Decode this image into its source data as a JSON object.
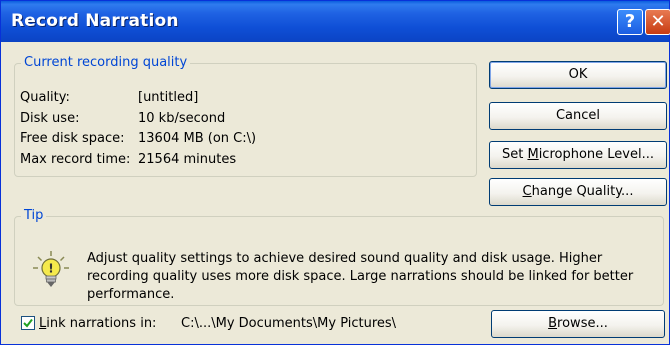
{
  "window": {
    "title": "Record Narration"
  },
  "title_buttons": {
    "help": "?",
    "close": "✕"
  },
  "quality_group": {
    "legend": "Current recording quality",
    "rows": [
      {
        "label": "Quality:",
        "value": "[untitled]"
      },
      {
        "label": "Disk use:",
        "value": "10 kb/second"
      },
      {
        "label": "Free disk space:",
        "value": "13604 MB (on C:\\)"
      },
      {
        "label": "Max record time:",
        "value": "21564 minutes"
      }
    ]
  },
  "buttons": {
    "ok": "OK",
    "cancel": "Cancel",
    "set_mic_pre": "Set ",
    "set_mic_key": "M",
    "set_mic_post": "icrophone Level...",
    "change_quality_key": "C",
    "change_quality_post": "hange Quality...",
    "browse_key": "B",
    "browse_post": "rowse..."
  },
  "tip_group": {
    "legend": "Tip",
    "text_line1": "Adjust quality settings to achieve desired sound quality and disk usage. Higher",
    "text_line2": "recording quality uses more disk space. Large narrations should be linked for better",
    "text_line3": "performance."
  },
  "link": {
    "checked": true,
    "label_key": "L",
    "label_post": "ink narrations in:",
    "path": "C:\\...\\My Documents\\My Pictures\\"
  },
  "icons": {
    "tip": "lightbulb-icon",
    "check": "checkmark-icon"
  }
}
